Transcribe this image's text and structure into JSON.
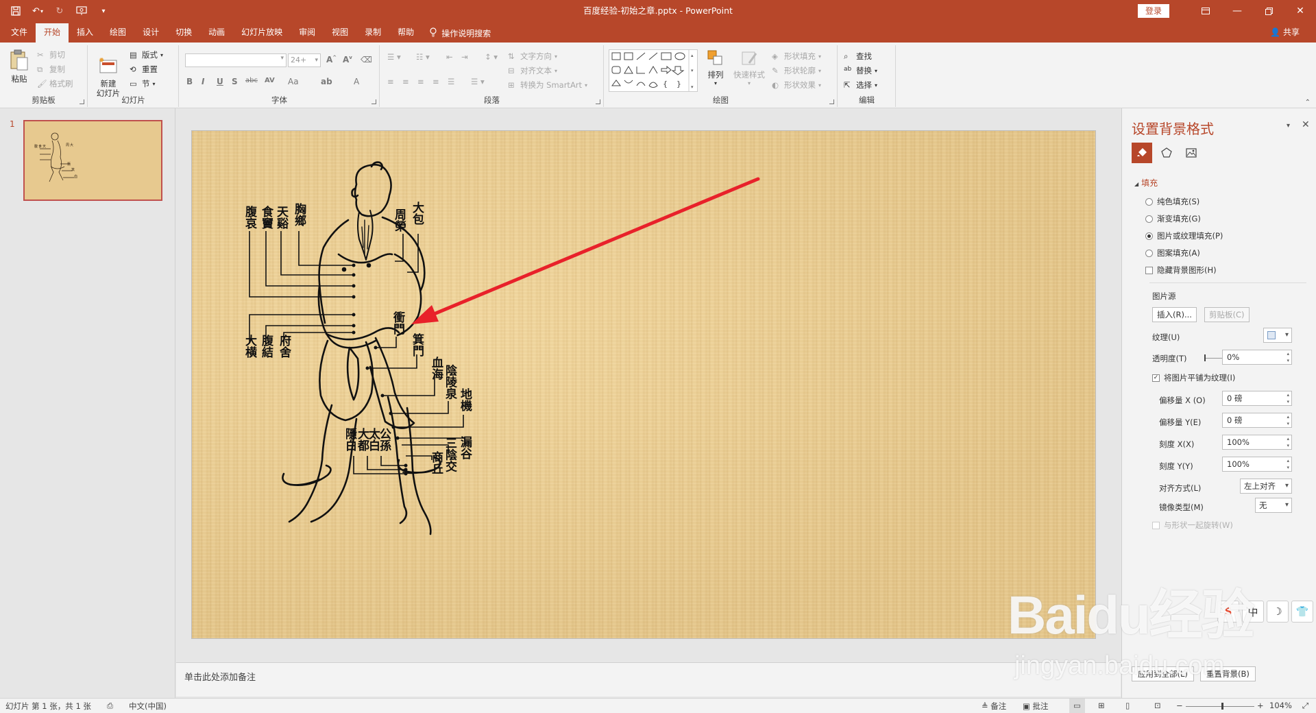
{
  "titlebar": {
    "doc_title": "百度经验-初始之章.pptx  -  PowerPoint",
    "login": "登录",
    "qat": [
      "save-icon",
      "undo-icon",
      "redo-icon",
      "slideshow-from-start-icon",
      "customize-qat-icon"
    ],
    "window_buttons": [
      "ribbon-display-icon",
      "minimize-icon",
      "restore-icon",
      "close-icon"
    ]
  },
  "tabs": [
    "文件",
    "开始",
    "插入",
    "绘图",
    "设计",
    "切换",
    "动画",
    "幻灯片放映",
    "审阅",
    "视图",
    "录制",
    "帮助"
  ],
  "active_tab": "开始",
  "tell_me": "操作说明搜索",
  "share": "共享",
  "ribbon": {
    "clipboard": {
      "label": "剪贴板",
      "paste": "粘贴",
      "cut": "剪切",
      "copy": "复制",
      "format_painter": "格式刷"
    },
    "slides": {
      "label": "幻灯片",
      "new_slide": "新建\n幻灯片",
      "layout": "版式",
      "reset": "重置",
      "section": "节"
    },
    "font": {
      "label": "字体",
      "font_name": "",
      "font_size": "24+",
      "buttons": [
        "B",
        "I",
        "U",
        "S",
        "abc",
        "AV",
        "Aa",
        "A"
      ]
    },
    "paragraph": {
      "label": "段落",
      "text_direction": "文字方向",
      "align_text": "对齐文本",
      "smartart": "转换为 SmartArt"
    },
    "drawing": {
      "label": "绘图",
      "arrange": "排列",
      "quick_styles": "快速样式",
      "shape_fill": "形状填充",
      "shape_outline": "形状轮廓",
      "shape_effects": "形状效果"
    },
    "editing": {
      "label": "编辑",
      "find": "查找",
      "replace": "替换",
      "select": "选择"
    }
  },
  "slides_pane": {
    "slide_number": "1"
  },
  "notes": {
    "placeholder": "单击此处添加备注"
  },
  "format_pane": {
    "title": "设置背景格式",
    "section": "填充",
    "fill_options": [
      {
        "label": "纯色填充(S)",
        "checked": false
      },
      {
        "label": "渐变填充(G)",
        "checked": false
      },
      {
        "label": "图片或纹理填充(P)",
        "checked": true
      },
      {
        "label": "图案填充(A)",
        "checked": false
      }
    ],
    "hide_bg": "隐藏背景图形(H)",
    "picture_source": "图片源",
    "insert_btn": "插入(R)...",
    "clipboard_btn": "剪贴板(C)",
    "texture_label": "纹理(U)",
    "transparency_label": "透明度(T)",
    "transparency_value": "0%",
    "tile_label": "将图片平铺为纹理(I)",
    "offset_x_label": "偏移量 X (O)",
    "offset_x_value": "0 磅",
    "offset_y_label": "偏移量 Y(E)",
    "offset_y_value": "0 磅",
    "scale_x_label": "刻度 X(X)",
    "scale_x_value": "100%",
    "scale_y_label": "刻度 Y(Y)",
    "scale_y_value": "100%",
    "align_label": "对齐方式(L)",
    "align_value": "左上对齐",
    "mirror_label": "镜像类型(M)",
    "mirror_value": "无",
    "rotate_label": "与形状一起旋转(W)",
    "apply_all": "应用到全部(L)",
    "reset_bg": "重置背景(B)"
  },
  "slide_content": {
    "labels": {
      "top_left": [
        "腹哀",
        "食竇",
        "天谿",
        "胸鄉"
      ],
      "top_right": [
        "周榮",
        "大包"
      ],
      "mid_left": [
        "大横",
        "腹結",
        "府舍"
      ],
      "mid_right_1": "衝門",
      "mid_right_2": "箕門",
      "right": [
        "血海",
        "陰陵泉",
        "地機",
        "漏谷",
        "三陰交",
        "商丘"
      ],
      "foot": [
        "隱白",
        "大都",
        "太白",
        "公孫"
      ]
    }
  },
  "statusbar": {
    "slide_info": "幻灯片 第 1 张，共 1 张",
    "language": "中文(中国)",
    "notes": "备注",
    "comments": "批注",
    "zoom": "104%"
  },
  "watermark": {
    "brand": "Baidu经验",
    "url": "jingyan.baidu.com"
  },
  "float_toolbar": [
    "中",
    "☽",
    "👕"
  ],
  "colors": {
    "accent": "#b7472a",
    "arrow": "#e8212a",
    "parchment": "#e6c98e"
  }
}
